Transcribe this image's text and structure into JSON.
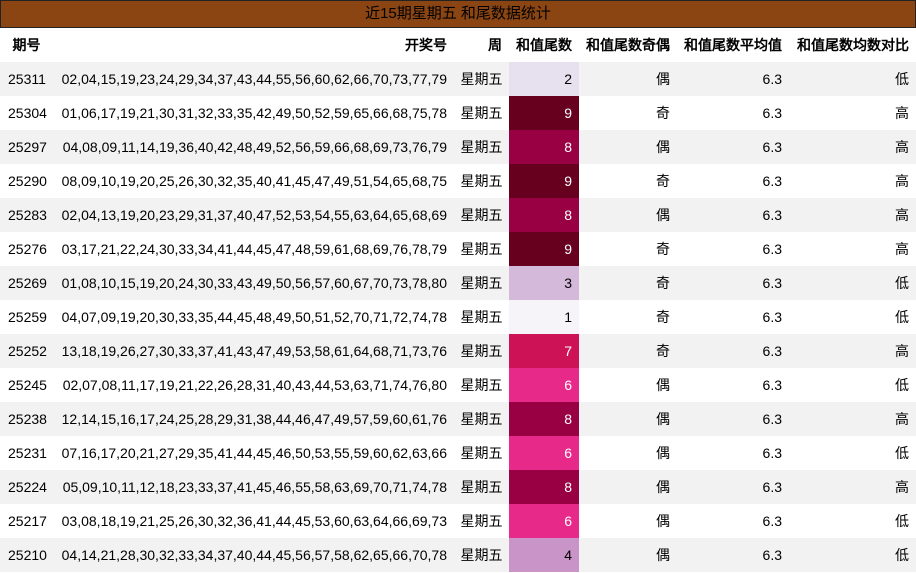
{
  "title": "近15期星期五 和尾数据统计",
  "headers": {
    "id": "期号",
    "numbers": "开奖号",
    "week": "周",
    "tail": "和值尾数",
    "parity": "和值尾数奇偶",
    "avg": "和值尾数平均值",
    "cmp": "和值尾数均数对比"
  },
  "rows": [
    {
      "id": "25311",
      "numbers": "02,04,15,19,23,24,29,34,37,43,44,55,56,60,62,66,70,73,77,79",
      "week": "星期五",
      "tail": "2",
      "parity": "偶",
      "avg": "6.3",
      "cmp": "低"
    },
    {
      "id": "25304",
      "numbers": "01,06,17,19,21,30,31,32,33,35,42,49,50,52,59,65,66,68,75,78",
      "week": "星期五",
      "tail": "9",
      "parity": "奇",
      "avg": "6.3",
      "cmp": "高"
    },
    {
      "id": "25297",
      "numbers": "04,08,09,11,14,19,36,40,42,48,49,52,56,59,66,68,69,73,76,79",
      "week": "星期五",
      "tail": "8",
      "parity": "偶",
      "avg": "6.3",
      "cmp": "高"
    },
    {
      "id": "25290",
      "numbers": "08,09,10,19,20,25,26,30,32,35,40,41,45,47,49,51,54,65,68,75",
      "week": "星期五",
      "tail": "9",
      "parity": "奇",
      "avg": "6.3",
      "cmp": "高"
    },
    {
      "id": "25283",
      "numbers": "02,04,13,19,20,23,29,31,37,40,47,52,53,54,55,63,64,65,68,69",
      "week": "星期五",
      "tail": "8",
      "parity": "偶",
      "avg": "6.3",
      "cmp": "高"
    },
    {
      "id": "25276",
      "numbers": "03,17,21,22,24,30,33,34,41,44,45,47,48,59,61,68,69,76,78,79",
      "week": "星期五",
      "tail": "9",
      "parity": "奇",
      "avg": "6.3",
      "cmp": "高"
    },
    {
      "id": "25269",
      "numbers": "01,08,10,15,19,20,24,30,33,43,49,50,56,57,60,67,70,73,78,80",
      "week": "星期五",
      "tail": "3",
      "parity": "奇",
      "avg": "6.3",
      "cmp": "低"
    },
    {
      "id": "25259",
      "numbers": "04,07,09,19,20,30,33,35,44,45,48,49,50,51,52,70,71,72,74,78",
      "week": "星期五",
      "tail": "1",
      "parity": "奇",
      "avg": "6.3",
      "cmp": "低"
    },
    {
      "id": "25252",
      "numbers": "13,18,19,26,27,30,33,37,41,43,47,49,53,58,61,64,68,71,73,76",
      "week": "星期五",
      "tail": "7",
      "parity": "奇",
      "avg": "6.3",
      "cmp": "高"
    },
    {
      "id": "25245",
      "numbers": "02,07,08,11,17,19,21,22,26,28,31,40,43,44,53,63,71,74,76,80",
      "week": "星期五",
      "tail": "6",
      "parity": "偶",
      "avg": "6.3",
      "cmp": "低"
    },
    {
      "id": "25238",
      "numbers": "12,14,15,16,17,24,25,28,29,31,38,44,46,47,49,57,59,60,61,76",
      "week": "星期五",
      "tail": "8",
      "parity": "偶",
      "avg": "6.3",
      "cmp": "高"
    },
    {
      "id": "25231",
      "numbers": "07,16,17,20,21,27,29,35,41,44,45,46,50,53,55,59,60,62,63,66",
      "week": "星期五",
      "tail": "6",
      "parity": "偶",
      "avg": "6.3",
      "cmp": "低"
    },
    {
      "id": "25224",
      "numbers": "05,09,10,11,12,18,23,33,37,41,45,46,55,58,63,69,70,71,74,78",
      "week": "星期五",
      "tail": "8",
      "parity": "偶",
      "avg": "6.3",
      "cmp": "高"
    },
    {
      "id": "25217",
      "numbers": "03,08,18,19,21,25,26,30,32,36,41,44,45,53,60,63,64,66,69,73",
      "week": "星期五",
      "tail": "6",
      "parity": "偶",
      "avg": "6.3",
      "cmp": "低"
    },
    {
      "id": "25210",
      "numbers": "04,14,21,28,30,32,33,34,37,40,44,45,56,57,58,62,65,66,70,78",
      "week": "星期五",
      "tail": "4",
      "parity": "偶",
      "avg": "6.3",
      "cmp": "低"
    }
  ],
  "tail_colors": {
    "1": "#f7f4f9",
    "2": "#e7e1ef",
    "3": "#d4b9da",
    "4": "#c994c7",
    "6": "#e7298a",
    "7": "#ce1256",
    "8": "#980043",
    "9": "#67001f"
  }
}
